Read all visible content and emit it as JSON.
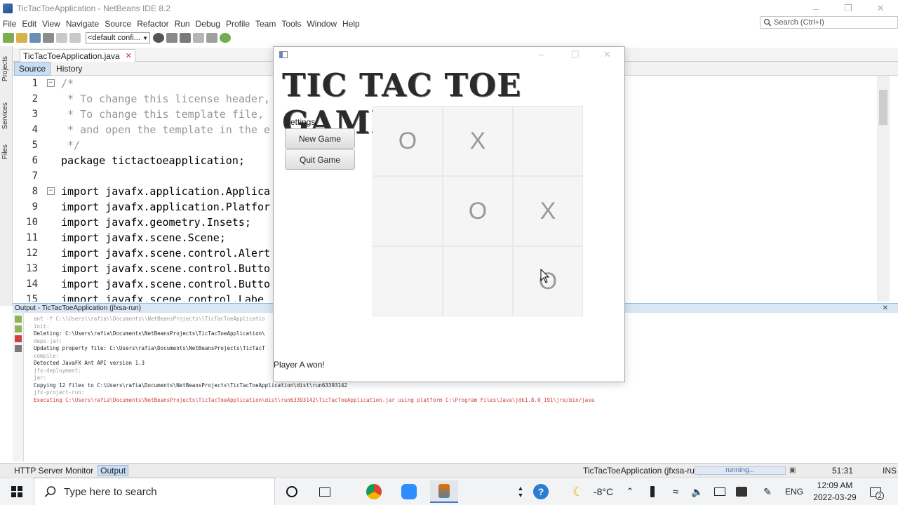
{
  "ide": {
    "title": "TicTacToeApplication - NetBeans IDE 8.2",
    "menus": [
      "File",
      "Edit",
      "View",
      "Navigate",
      "Source",
      "Refactor",
      "Run",
      "Debug",
      "Profile",
      "Team",
      "Tools",
      "Window",
      "Help"
    ],
    "search_placeholder": "Search (Ctrl+I)",
    "config": "<default confi...",
    "side_tabs": [
      "Projects",
      "Services",
      "Files"
    ],
    "file_tab": "TicTacToeApplication.java",
    "editor_tabs": [
      "Source",
      "History"
    ],
    "code_lines": [
      {
        "n": "1",
        "text": "/*",
        "comment": true
      },
      {
        "n": "2",
        "text": " * To change this license header,",
        "comment": true
      },
      {
        "n": "3",
        "text": " * To change this template file,",
        "comment": true
      },
      {
        "n": "4",
        "text": " * and open the template in the e",
        "comment": true
      },
      {
        "n": "5",
        "text": " */",
        "comment": true
      },
      {
        "n": "6",
        "text": "package tictactoeapplication;",
        "comment": false
      },
      {
        "n": "7",
        "text": "",
        "comment": false
      },
      {
        "n": "8",
        "text": "import javafx.application.Applica",
        "comment": false
      },
      {
        "n": "9",
        "text": "import javafx.application.Platfor",
        "comment": false
      },
      {
        "n": "10",
        "text": "import javafx.geometry.Insets;",
        "comment": false
      },
      {
        "n": "11",
        "text": "import javafx.scene.Scene;",
        "comment": false
      },
      {
        "n": "12",
        "text": "import javafx.scene.control.Alert",
        "comment": false
      },
      {
        "n": "13",
        "text": "import javafx.scene.control.Butto",
        "comment": false
      },
      {
        "n": "14",
        "text": "import javafx.scene.control.Butto",
        "comment": false
      },
      {
        "n": "15",
        "text": "import javafx.scene.control.Labe",
        "comment": false
      }
    ],
    "output_title": "Output - TicTacToeApplication (jfxsa-run)",
    "output_lines": [
      {
        "text": "ant -f C:\\\\Users\\\\rafia\\\\Documents\\\\NetBeansProjects\\\\TicTacToeApplicatio",
        "color": "#9a9a9a"
      },
      {
        "text": "init:",
        "color": "#9a9a9a"
      },
      {
        "text": "Deleting: C:\\Users\\rafia\\Documents\\NetBeansProjects\\TicTacToeApplication\\",
        "color": "#222"
      },
      {
        "text": "deps-jar:",
        "color": "#9a9a9a"
      },
      {
        "text": "Updating property file: C:\\Users\\rafia\\Documents\\NetBeansProjects\\TicTacT",
        "color": "#222"
      },
      {
        "text": "compile:",
        "color": "#9a9a9a"
      },
      {
        "text": "Detected JavaFX Ant API version 1.3",
        "color": "#222"
      },
      {
        "text": "jfx-deployment:",
        "color": "#9a9a9a"
      },
      {
        "text": "jar:",
        "color": "#9a9a9a"
      },
      {
        "text": "Copying 12 files to C:\\Users\\rafia\\Documents\\NetBeansProjects\\TicTacToeApplication\\dist\\run63393142",
        "color": "#222"
      },
      {
        "text": "jfx-project-run:",
        "color": "#9a9a9a"
      },
      {
        "text": "Executing C:\\Users\\rafia\\Documents\\NetBeansProjects\\TicTacToeApplication\\dist\\run63393142\\TicTacToeApplication.jar using platform C:\\Program Files\\Java\\jdk1.8.0_191\\jre/bin/java",
        "color": "#d04040"
      }
    ],
    "status": {
      "http_monitor": "HTTP Server Monitor",
      "output_tab": "Output",
      "task": "TicTacToeApplication (jfxsa-run)",
      "progress": "running...",
      "position": "51:31",
      "mode": "INS"
    }
  },
  "game": {
    "heading": "TIC TAC TOE GAME",
    "settings_label": "Settings:",
    "new_game": "New Game",
    "quit_game": "Quit Game",
    "board": [
      [
        "O",
        "X",
        ""
      ],
      [
        "",
        "O",
        "X"
      ],
      [
        "",
        "",
        "O"
      ]
    ],
    "status_message": "Player A won!"
  },
  "taskbar": {
    "search_placeholder": "Type here to search",
    "temperature": "-8°C",
    "language": "ENG",
    "time": "12:09 AM",
    "date": "2022-03-29",
    "notification_count": "2"
  }
}
